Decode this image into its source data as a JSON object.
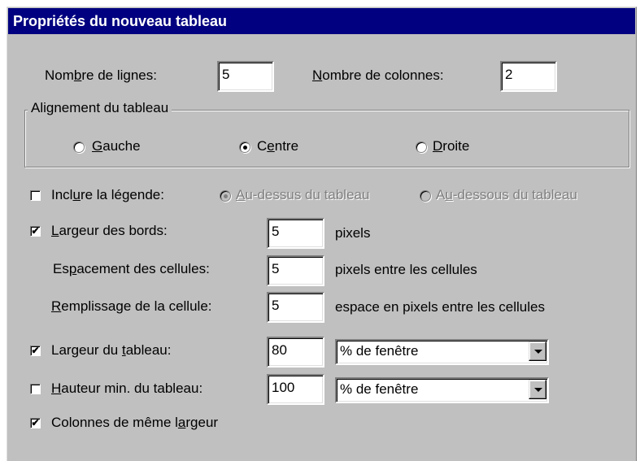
{
  "title": "Propriétés du nouveau tableau",
  "rows_label_pre": "Nom",
  "rows_label_u": "b",
  "rows_label_post": "re de lignes:",
  "rows_value": "5",
  "cols_label_pre": "",
  "cols_label_u": "N",
  "cols_label_post": "ombre de colonnes:",
  "cols_value": "2",
  "alignment": {
    "legend": "Alignement du tableau",
    "left": {
      "u": "G",
      "rest": "auche",
      "pre": ""
    },
    "center": {
      "pre": "C",
      "u": "e",
      "rest": "ntre"
    },
    "right": {
      "pre": "",
      "u": "D",
      "rest": "roite"
    },
    "selected": "center"
  },
  "caption": {
    "label_pre": "Incl",
    "label_u": "u",
    "label_post": "re la légende:",
    "above_pre": "",
    "above_u": "A",
    "above_post": "u-dessus du tableau",
    "below_pre": "A",
    "below_u": "u",
    "below_post": "-dessous du tableau",
    "checked": false
  },
  "border": {
    "label_pre": "",
    "label_u": "L",
    "label_post": "argeur des bords:",
    "value": "5",
    "unit": "pixels",
    "checked": true
  },
  "spacing": {
    "label_pre": "Es",
    "label_u": "p",
    "label_post": "acement des cellules:",
    "value": "5",
    "unit": "pixels entre les cellules"
  },
  "padding": {
    "label_pre": "",
    "label_u": "R",
    "label_post": "emplissage de la cellule:",
    "value": "5",
    "unit": "espace en pixels entre les cellules"
  },
  "width": {
    "label_pre": "Largeur du ",
    "label_u": "t",
    "label_post": "ableau:",
    "value": "80",
    "unit": "% de fenêtre",
    "checked": true
  },
  "height": {
    "label_pre": "",
    "label_u": "H",
    "label_post": "auteur min. du tableau:",
    "value": "100",
    "unit": "% de fenêtre",
    "checked": false
  },
  "equal_cols": {
    "label_pre": "Colonnes de même l",
    "label_u": "a",
    "label_post": "rgeur",
    "checked": true
  },
  "check_mark": "✔"
}
